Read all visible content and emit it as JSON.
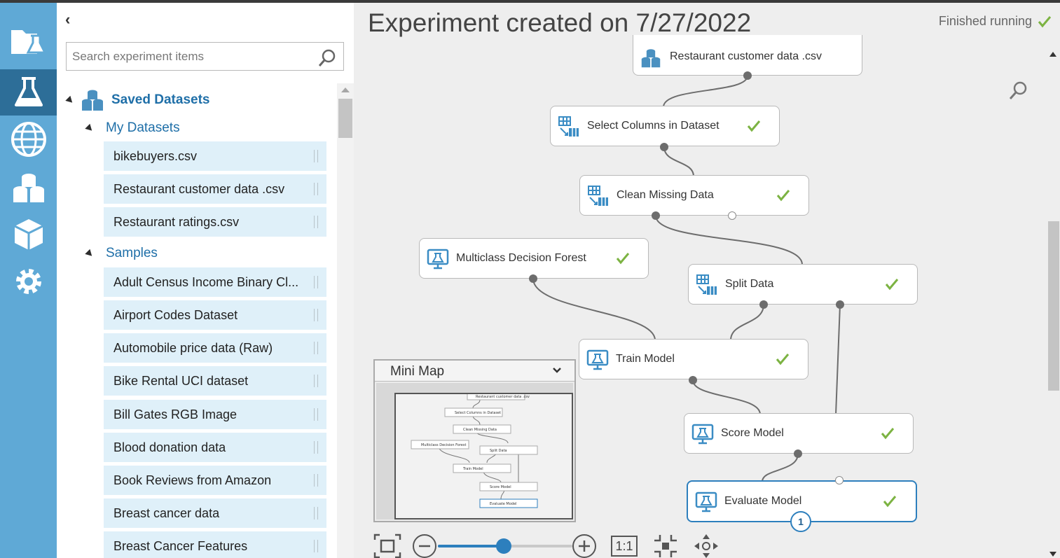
{
  "nav": {
    "items": [
      {
        "name": "projects",
        "icon": "folder-flask-icon",
        "active": false
      },
      {
        "name": "experiments",
        "icon": "flask-icon",
        "active": true
      },
      {
        "name": "web-services",
        "icon": "globe-icon",
        "active": false
      },
      {
        "name": "datasets",
        "icon": "datasets-icon",
        "active": false
      },
      {
        "name": "trained-models",
        "icon": "cube-icon",
        "active": false
      },
      {
        "name": "settings",
        "icon": "gear-icon",
        "active": false
      }
    ]
  },
  "palette": {
    "collapse_label": "‹",
    "search": {
      "placeholder": "Search experiment items",
      "value": ""
    },
    "saved_datasets": {
      "label": "Saved Datasets",
      "my_datasets": {
        "label": "My Datasets",
        "items": [
          "bikebuyers.csv",
          "Restaurant customer data .csv",
          "Restaurant ratings.csv"
        ]
      },
      "samples": {
        "label": "Samples",
        "items": [
          "Adult Census Income Binary Cl...",
          "Airport Codes Dataset",
          "Automobile price data (Raw)",
          "Bike Rental UCI dataset",
          "Bill Gates RGB Image",
          "Blood donation data",
          "Book Reviews from Amazon",
          "Breast cancer data",
          "Breast Cancer Features"
        ]
      }
    }
  },
  "experiment": {
    "title": "Experiment created on 7/27/2022",
    "status": "Finished running",
    "colors": {
      "accent": "#2d7fbd",
      "check": "#7cb342",
      "rail": "#5fa9d6",
      "rail_active": "#2d6e98"
    },
    "modules": [
      {
        "id": "restaurant-customer-data",
        "label": "Restaurant customer data .csv",
        "icon": "dataset-icon",
        "done": false
      },
      {
        "id": "select-columns",
        "label": "Select Columns in Dataset",
        "icon": "transform-icon",
        "done": true
      },
      {
        "id": "clean-missing",
        "label": "Clean Missing Data",
        "icon": "transform-icon",
        "done": true
      },
      {
        "id": "multiclass-forest",
        "label": "Multiclass Decision Forest",
        "icon": "model-icon",
        "done": true
      },
      {
        "id": "split-data",
        "label": "Split Data",
        "icon": "transform-icon",
        "done": true
      },
      {
        "id": "train-model",
        "label": "Train Model",
        "icon": "model-icon",
        "done": true
      },
      {
        "id": "score-model",
        "label": "Score Model",
        "icon": "model-icon",
        "done": true
      },
      {
        "id": "evaluate-model",
        "label": "Evaluate Model",
        "icon": "model-icon",
        "done": true,
        "selected": true,
        "badge": "1"
      }
    ]
  },
  "minimap": {
    "title": "Mini Map",
    "labels": [
      "Restaurant customer data .csv",
      "Select Columns in Dataset",
      "Clean Missing Data",
      "Multiclass Decision Forest",
      "Split Data",
      "Train Model",
      "Score Model",
      "Evaluate Model"
    ]
  },
  "zoom": {
    "one_to_one_label": "1:1",
    "level_fraction": 0.49
  }
}
